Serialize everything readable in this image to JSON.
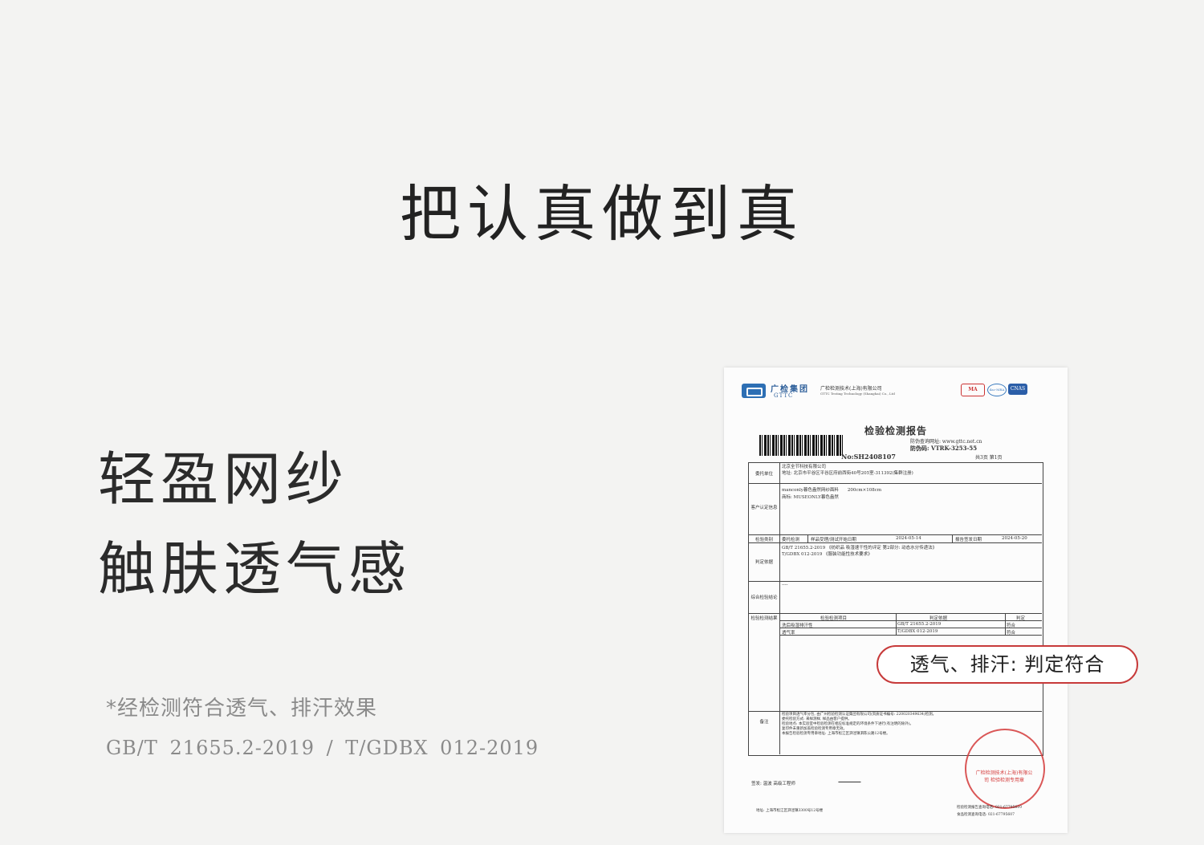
{
  "headline": "把认真做到真",
  "features": [
    "轻盈网纱",
    "触肤透气感"
  ],
  "note": "*经检测符合透气、排汗效果",
  "standards": "GB/T 21655.2-2019 / T/GDBX 012-2019",
  "badge": "透气、排汗: 判定符合",
  "report": {
    "org_cn": "广检集团",
    "org_en": "GTTC",
    "company_cn": "广检检测技术(上海)有限公司",
    "company_en": "GTTC Testing Technology (Shanghai) Co., Ltd",
    "marks": [
      "MA",
      "ilac-MRA",
      "CNAS"
    ],
    "title": "检验检测报告",
    "number": "No:SH2408107",
    "query_site": "防伪查询网址: www.gttc.net.cn",
    "anti_fake": "防伪码: VTRK-3253-55",
    "pages": "共3页 第1页",
    "client_label": "委托单位",
    "client_name": "北京全节科技有限公司",
    "client_address": "地址: 北京市平谷区平谷区府前西街40号205室-311392(集群注册)",
    "sample_label": "客户认定信息",
    "sample_line1": "manconly暮色盎然网纱面料　　200cm×108cm",
    "sample_line2": "商标: MUSEONLY暮色盎然",
    "test_type_label": "检验类别",
    "test_type": "委托检测",
    "receive_label": "样品受理/测试开始日期",
    "receive_date": "2024-05-14",
    "issue_label": "报告签发日期",
    "issue_date": "2024-05-20",
    "basis_label": "判定依据",
    "basis_line1": "GB/T 21655.2-2019 《纺织品 吸湿速干性的评定 第2部分: 动态水分传递法》",
    "basis_line2": "T/GDBX 012-2019 《服装功能性技术要求》",
    "conclusion_label": "综合检验结论",
    "conclusion": "----",
    "results_label": "检验检测结果",
    "result_headers": [
      "检验检测项目",
      "判定依据",
      "判定"
    ],
    "results": [
      [
        "洗后吸湿排汗性",
        "GB/T 21655.2-2019",
        "符合"
      ],
      [
        "透气率",
        "T/GDBX 012-2019",
        "符合"
      ]
    ],
    "remark_label": "备注",
    "remark_lines": [
      "检验项目透气率分包, 由广州检验检测认证集团有限公司(资质证书编号: 220020349634)检测。",
      "委托检验方式: 来样测样, 样品由客户提供。",
      "检验地点: 本实验室中检验检测在相应标准规定的环境条件下进行(有注明的除外)。",
      "复印件未重新加盖检验检测专用章无效。",
      "本报告检验检测专用章地址: 上海市松江区泗泾镇泗陈公路12号楼。"
    ],
    "stamp_text": "广检检测技术(上海)有限公司 检验检测专用章",
    "signer_label": "签发: 温波 高级工程师",
    "footer_address": "地址: 上海市松江区泗泾镇3300号12号楼",
    "footer_phone1": "检验检测报告查询电话: 021-67795610",
    "footer_phone2": "食品检测查询电话: 021-67795607"
  }
}
